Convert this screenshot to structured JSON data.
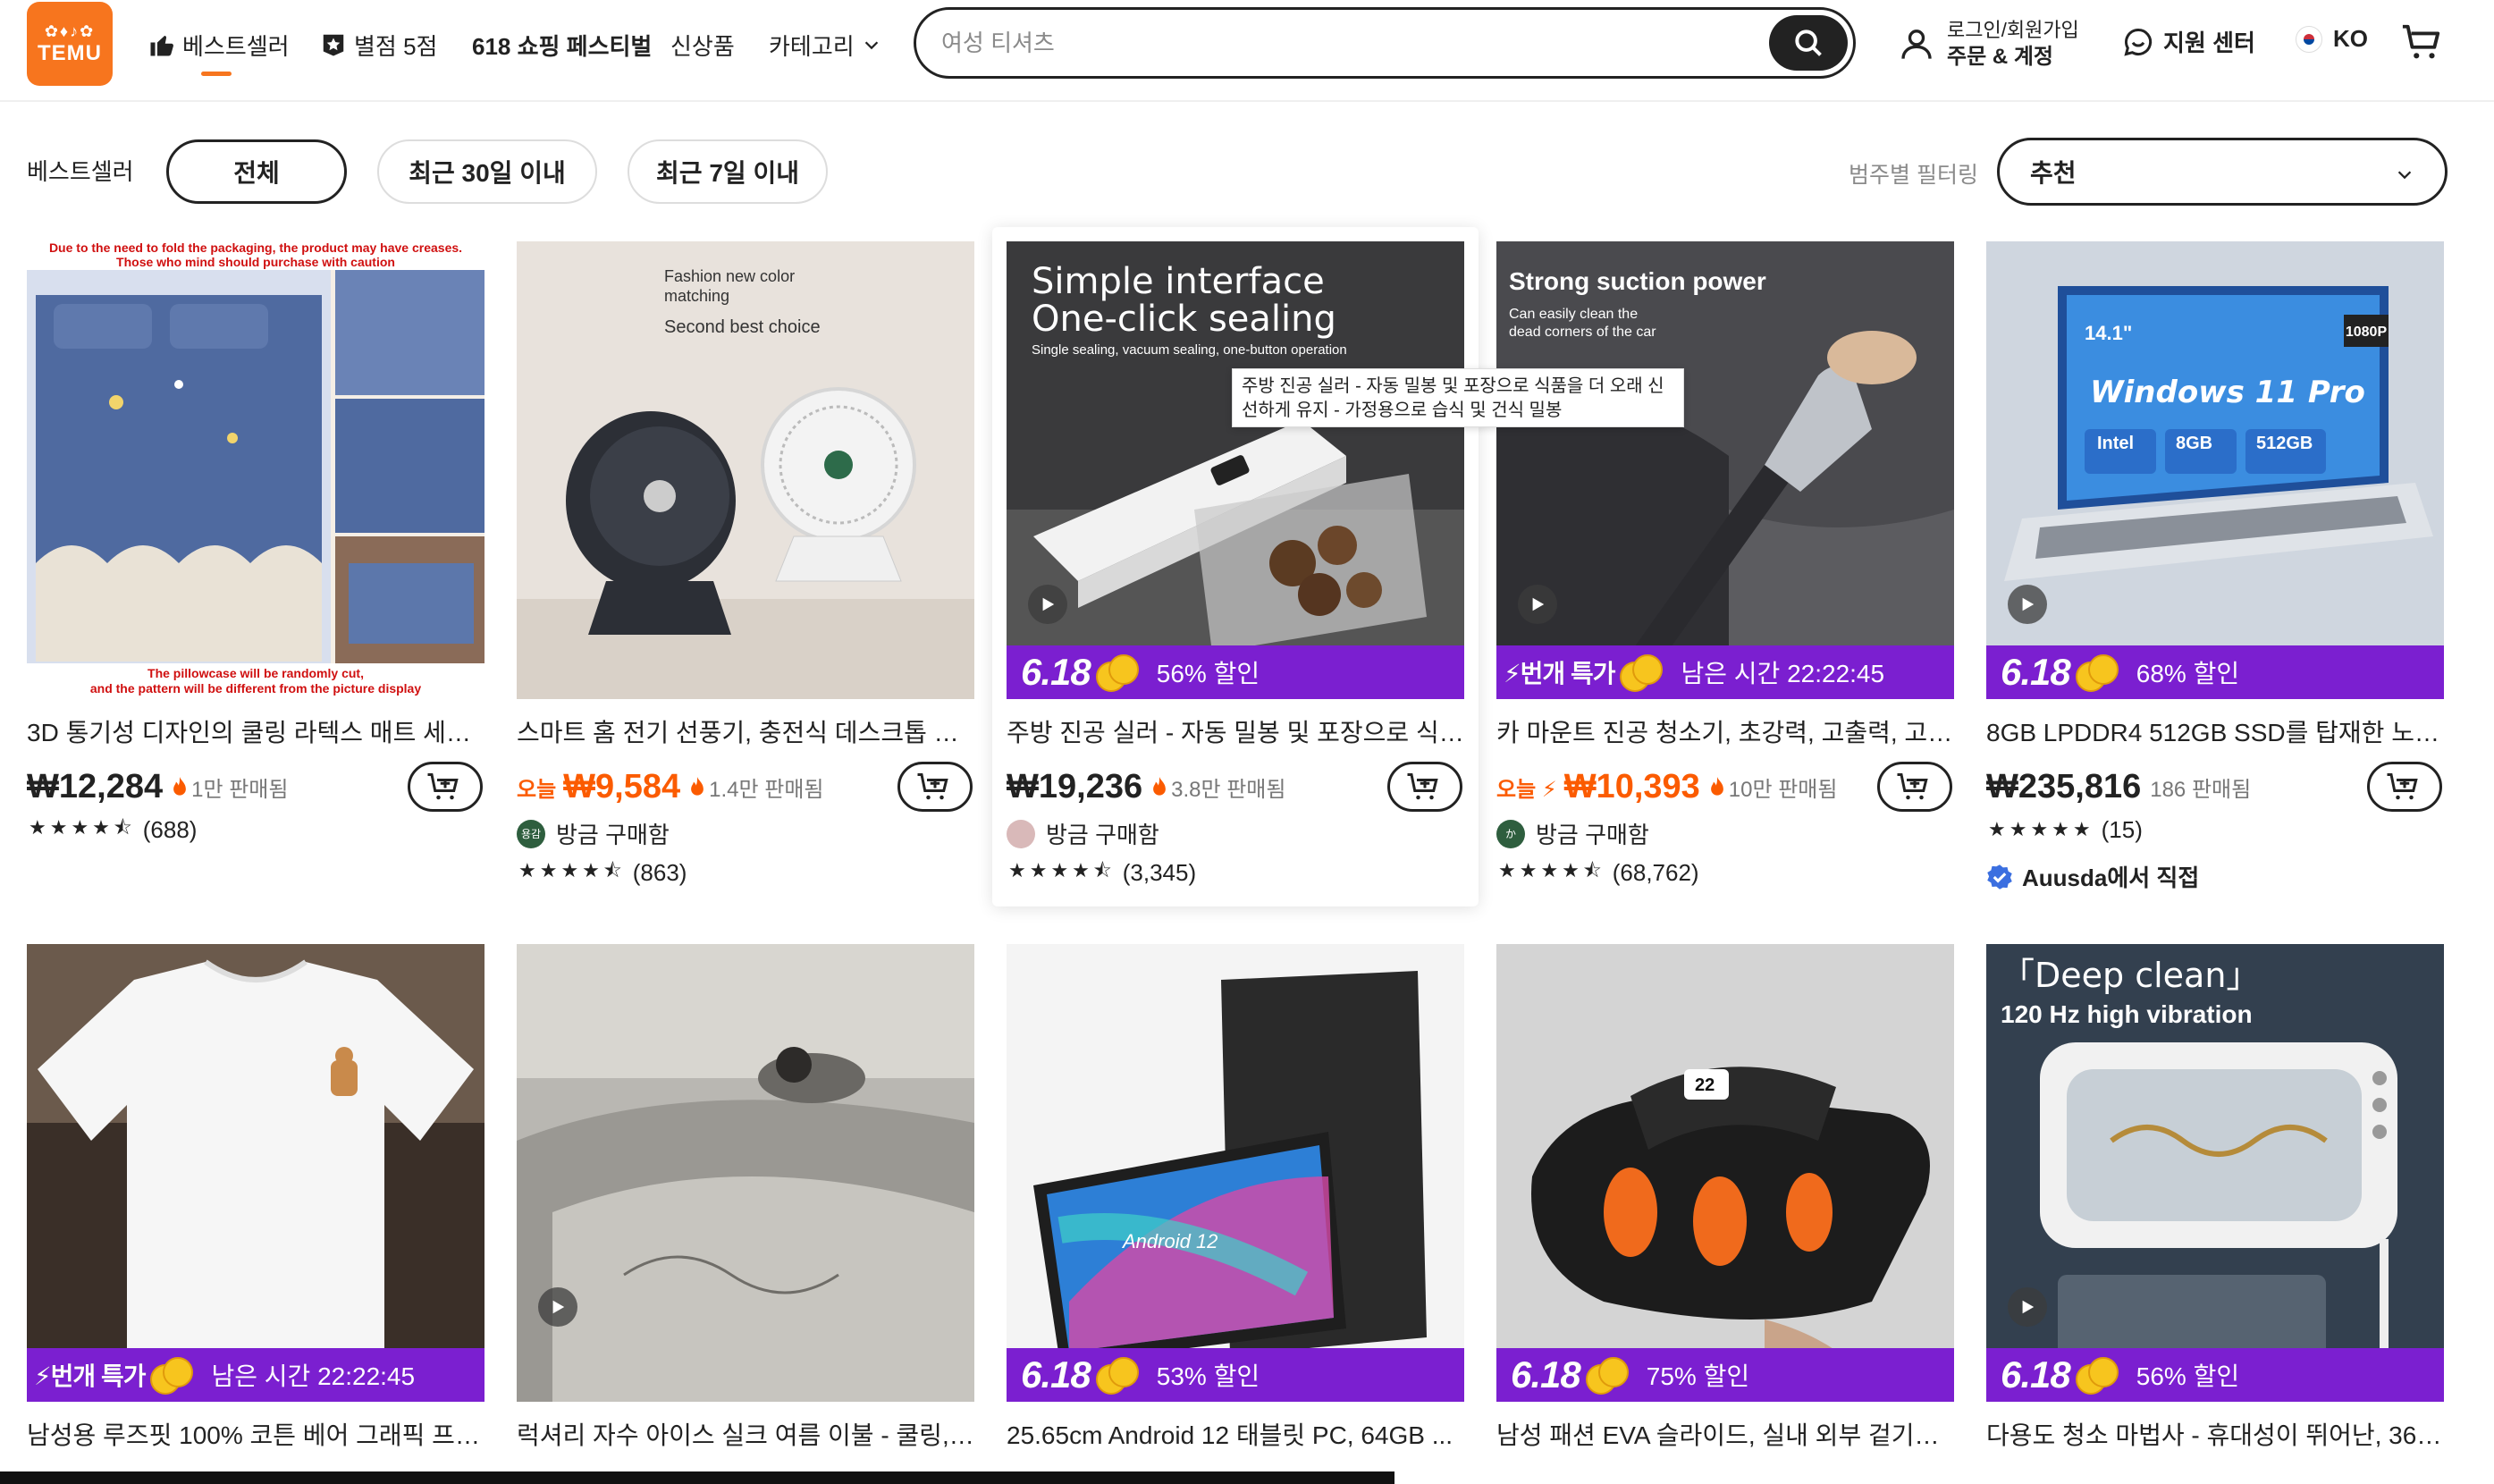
{
  "header": {
    "logo_glyphs": "✿♦︎♪✿",
    "logo_text": "TEMU",
    "nav": [
      {
        "label": "베스트셀러",
        "icon": "thumbs-up-icon"
      },
      {
        "label": "별점 5점",
        "icon": "star-badge-icon"
      },
      {
        "label": "618 쇼핑 페스티벌"
      },
      {
        "label": "신상품"
      },
      {
        "label": "카테고리",
        "icon": "chevron-down-icon"
      }
    ],
    "search_placeholder": "여성 티셔츠",
    "account_line1": "로그인/회원가입",
    "account_line2": "주문 & 계정",
    "support": "지원 센터",
    "language": "KO"
  },
  "filters": {
    "label": "베스트셀러",
    "pills": [
      "전체",
      "최근 30일 이내",
      "최근 7일 이내"
    ],
    "category_label": "범주별 필터링",
    "sort_value": "추천"
  },
  "tooltip": "주방 진공 실러 - 자동 밀봉 및 포장으로 식품을 더 오래 신선하게 유지 - 가정용으로 습식 및 건식 밀봉",
  "products": [
    {
      "title": "3D 통기성 디자인의 쿨링 라텍스 매트 세트 ...",
      "price": "₩12,284",
      "sold": "1만 판매됨",
      "rating": "(688)",
      "stars": "★★★★⯪"
    },
    {
      "title": "스마트 홈 전기 선풍기, 충전식 데스크톱 벽걸...",
      "today": "오늘",
      "price": "₩9,584",
      "sold": "1.4만 판매됨",
      "buyer": "방금 구매함",
      "avatar": "용감",
      "rating": "(863)",
      "stars": "★★★★⯪"
    },
    {
      "title": "주방 진공 실러 - 자동 밀봉 및 포장으로 식품...",
      "promo_tag": "6.18",
      "promo_text": "56% 할인",
      "price": "₩19,236",
      "sold": "3.8만 판매됨",
      "buyer": "방금 구매함",
      "rating": "(3,345)",
      "stars": "★★★★⯪"
    },
    {
      "title": "카 마운트 진공 청소기, 초강력, 고출력, 고흡...",
      "promo_tag": "⚡번개 특가",
      "promo_text": "남은 시간 22:22:45",
      "today": "오늘 ⚡",
      "price": "₩10,393",
      "sold": "10만 판매됨",
      "buyer": "방금 구매함",
      "avatar": "か",
      "rating": "(68,762)",
      "stars": "★★★★⯪"
    },
    {
      "title": "8GB LPDDR4 512GB SSD를 탑재한 노트...",
      "promo_tag": "6.18",
      "promo_text": "68% 할인",
      "price": "₩235,816",
      "sold": "186 판매됨",
      "rating": "(15)",
      "stars": "★★★★★",
      "seller": "Auusda에서 직접"
    },
    {
      "title": "남성용 루즈핏 100% 코튼 베어 그래픽 프린...",
      "promo_tag": "⚡번개 특가",
      "promo_text": "남은 시간 22:22:45"
    },
    {
      "title": "럭셔리 자수 아이스 실크 여름 이불 - 쿨링, ..."
    },
    {
      "title": "25.65cm Android 12 태블릿 PC, 64GB ...",
      "promo_tag": "6.18",
      "promo_text": "53% 할인"
    },
    {
      "title": "남성 패션 EVA 슬라이드, 실내 외부 겉기용 ...",
      "promo_tag": "6.18",
      "promo_text": "75% 할인"
    },
    {
      "title": "다용도 청소 마법사 - 휴대성이 뛰어난, 360...",
      "promo_tag": "6.18",
      "promo_text": "56% 할인"
    }
  ],
  "image_text": {
    "p1_top": "Due to the need to fold the packaging, the product may have creases. Those who mind should purchase with caution",
    "p1_bottom": "The pillowcase will be randomly cut, and the pattern will be different from the picture display",
    "p2_a": "Fashion new color matching",
    "p2_b": "Second best choice",
    "p3_a": "Simple interface",
    "p3_b": "One-click sealing",
    "p3_c": "Single sealing, vacuum sealing, one-button operation",
    "p4_a": "Strong suction power",
    "p4_b": "Can easily clean the dead corners of the car",
    "p5_a": "14.1\"",
    "p5_b": "Windows 11 Pro",
    "p5_c": "Intel",
    "p5_d": "8GB",
    "p5_e": "512GB",
    "p5_f": "1080P",
    "p8_a": "Android 12",
    "p9_a": "22",
    "p10_a": "「Deep clean」",
    "p10_b": "120 Hz high vibration"
  },
  "colors": {
    "brand": "#f7751e",
    "promo_purple": "#7b1fd0",
    "price_orange": "#fb5b00",
    "verified_blue": "#3b6fe0"
  }
}
